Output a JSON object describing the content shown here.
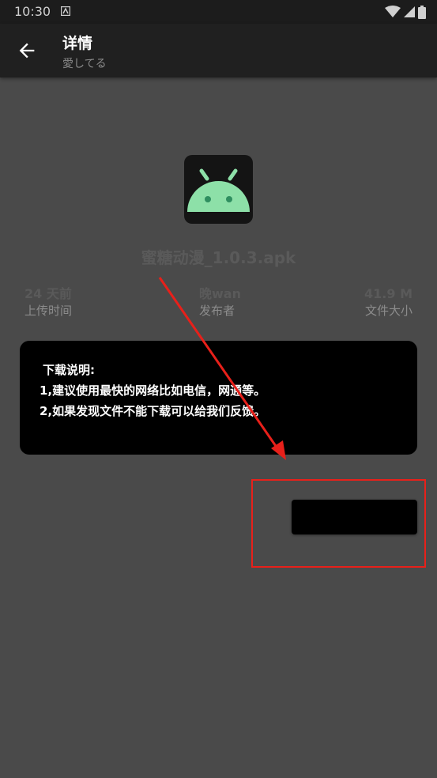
{
  "status_bar": {
    "time": "10:30"
  },
  "app_bar": {
    "title": "详情",
    "subtitle": "愛してる",
    "back_icon": "arrow-left-icon"
  },
  "file": {
    "icon": "android-icon",
    "name": "蜜糖动漫_1.0.3.apk"
  },
  "info": [
    {
      "value": "24 天前",
      "label": "上传时间"
    },
    {
      "value": "晚wan",
      "label": "发布者"
    },
    {
      "value": "41.9 M",
      "label": "文件大小"
    }
  ],
  "notice": {
    "lines": [
      "下载说明:",
      "1,建议使用最快的网络比如电信，网通等。",
      "2,如果发现文件不能下载可以给我们反馈。"
    ]
  },
  "colors": {
    "background": "#4a4a4a",
    "app_bar": "#202020",
    "android_green": "#8de0a8",
    "annotation_red": "#e8201a"
  }
}
